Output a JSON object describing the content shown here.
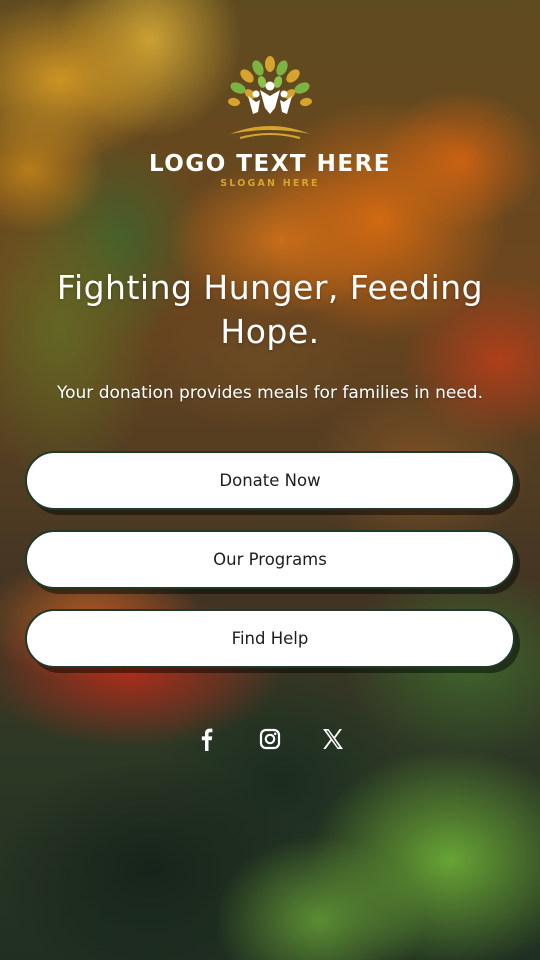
{
  "logo": {
    "text": "LOGO TEXT HERE",
    "slogan": "SLOGAN HERE",
    "icon": "tree-people-logo"
  },
  "hero": {
    "headline": "Fighting Hunger, Feeding Hope.",
    "subtext": "Your donation provides meals for families in need."
  },
  "buttons": {
    "donate": "Donate Now",
    "programs": "Our Programs",
    "find_help": "Find Help"
  },
  "social": [
    {
      "name": "facebook",
      "icon": "facebook-icon"
    },
    {
      "name": "instagram",
      "icon": "instagram-icon"
    },
    {
      "name": "x",
      "icon": "x-twitter-icon"
    }
  ],
  "colors": {
    "button_bg": "#ffffff",
    "button_border": "#1f3a2a",
    "slogan": "#d6a42e",
    "leaf_green": "#7cb342",
    "gold": "#d6a42e"
  }
}
